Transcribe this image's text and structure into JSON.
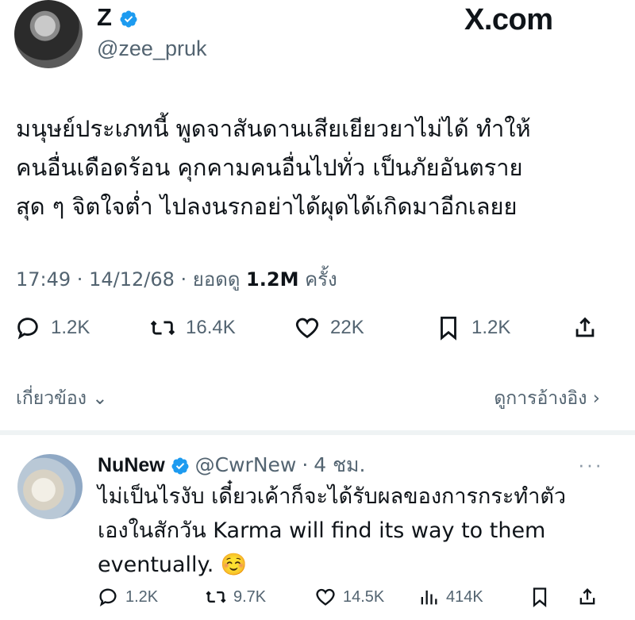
{
  "header": {
    "display_name": "Z",
    "handle": "@zee_pruk",
    "site_label": "X.com"
  },
  "tweet": {
    "lines": [
      "มนุษย์ประเภทนี้ พูดจาสันดานเสียเยียวยาไม่ได้ ทำให้",
      "คนอื่นเดือดร้อน คุกคามคนอื่นไปทั่ว เป็นภัยอันตราย",
      "สุด ๆ จิตใจต่ำ ไปลงนรกอย่าได้ผุดได้เกิดมาอีกเลยย"
    ],
    "time": "17:49",
    "date": "14/12/68",
    "views_label": "ยอดดู",
    "views_value": "1.2M",
    "views_unit": "ครั้ง",
    "stats": {
      "replies": "1.2K",
      "retweets": "16.4K",
      "likes": "22K",
      "bookmarks": "1.2K"
    },
    "related_label": "เกี่ยวข้อง",
    "quotes_label": "ดูการอ้างอิง"
  },
  "reply": {
    "display_name": "NuNew",
    "handle": "@CwrNew",
    "time_ago": "4 ชม.",
    "lines": [
      "ไม่เป็นไรงับ เดี๋ยวเค้าก็จะได้รับผลของการกระทำตัว",
      "เองในสักวัน Karma will find its way to them",
      "eventually. ☺️"
    ],
    "stats": {
      "replies": "1.2K",
      "retweets": "9.7K",
      "likes": "14.5K",
      "views": "414K"
    }
  },
  "colors": {
    "verified": "#1d9bf0",
    "muted_text": "#536471",
    "main_text": "#0f1419"
  }
}
